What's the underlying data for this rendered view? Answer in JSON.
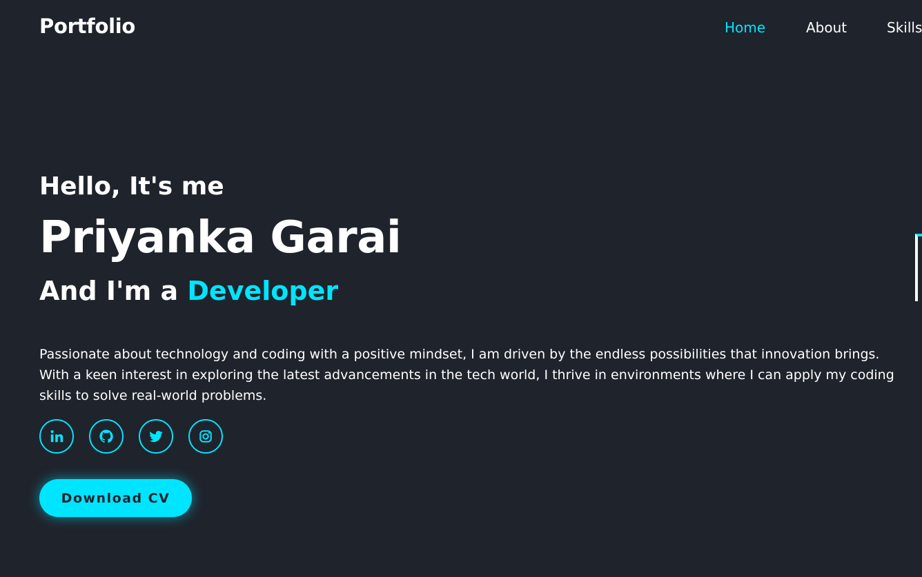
{
  "header": {
    "logo": "Portfolio",
    "nav": [
      {
        "label": "Home",
        "active": true
      },
      {
        "label": "About",
        "active": false
      },
      {
        "label": "Skills",
        "active": false
      }
    ]
  },
  "hero": {
    "greeting": "Hello, It's me",
    "name": "Priyanka Garai",
    "role_prefix": "And I'm a",
    "role_highlight": "Developer",
    "description": "Passionate about technology and coding with a positive mindset, I am driven by the endless possibilities that innovation brings. With a keen interest in exploring the latest advancements in the tech world, I thrive in environments where I can apply my coding skills to solve real-world problems.",
    "socials": [
      {
        "icon": "linkedin-icon"
      },
      {
        "icon": "github-icon"
      },
      {
        "icon": "twitter-icon"
      },
      {
        "icon": "instagram-icon"
      }
    ],
    "cta_label": "Download CV"
  },
  "colors": {
    "background": "#1f232c",
    "accent": "#00e5ff",
    "text": "#ffffff"
  }
}
